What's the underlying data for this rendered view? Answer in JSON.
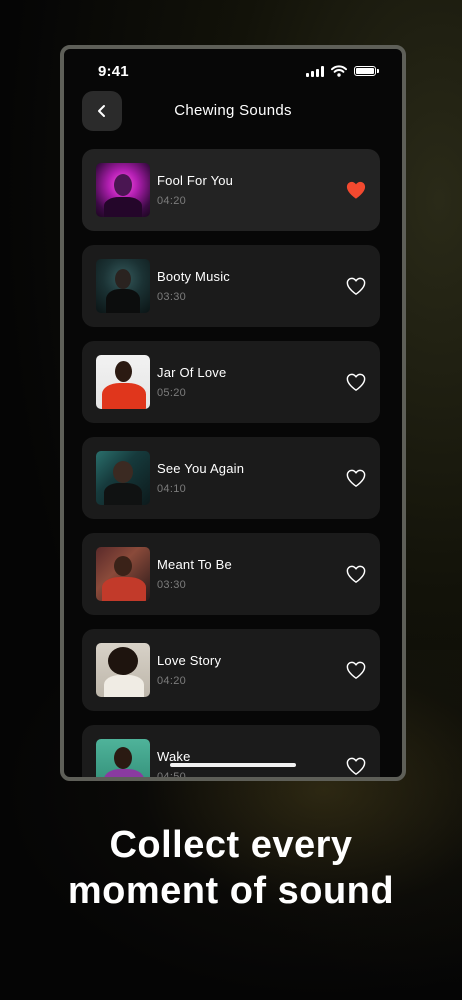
{
  "status_bar": {
    "time": "9:41"
  },
  "header": {
    "title": "Chewing Sounds"
  },
  "songs": [
    {
      "title": "Fool For You",
      "duration": "04:20",
      "liked": true
    },
    {
      "title": "Booty Music",
      "duration": "03:30",
      "liked": false
    },
    {
      "title": "Jar Of Love",
      "duration": "05:20",
      "liked": false
    },
    {
      "title": "See You Again",
      "duration": "04:10",
      "liked": false
    },
    {
      "title": "Meant To Be",
      "duration": "03:30",
      "liked": false
    },
    {
      "title": "Love Story",
      "duration": "04:20",
      "liked": false
    },
    {
      "title": "Wake",
      "duration": "04:50",
      "liked": false
    }
  ],
  "tagline": {
    "line1": "Collect every",
    "line2": "moment of sound"
  },
  "colors": {
    "liked_heart": "#f2492f",
    "card_bg": "#1b1b1b",
    "page_bg": "#050505"
  }
}
